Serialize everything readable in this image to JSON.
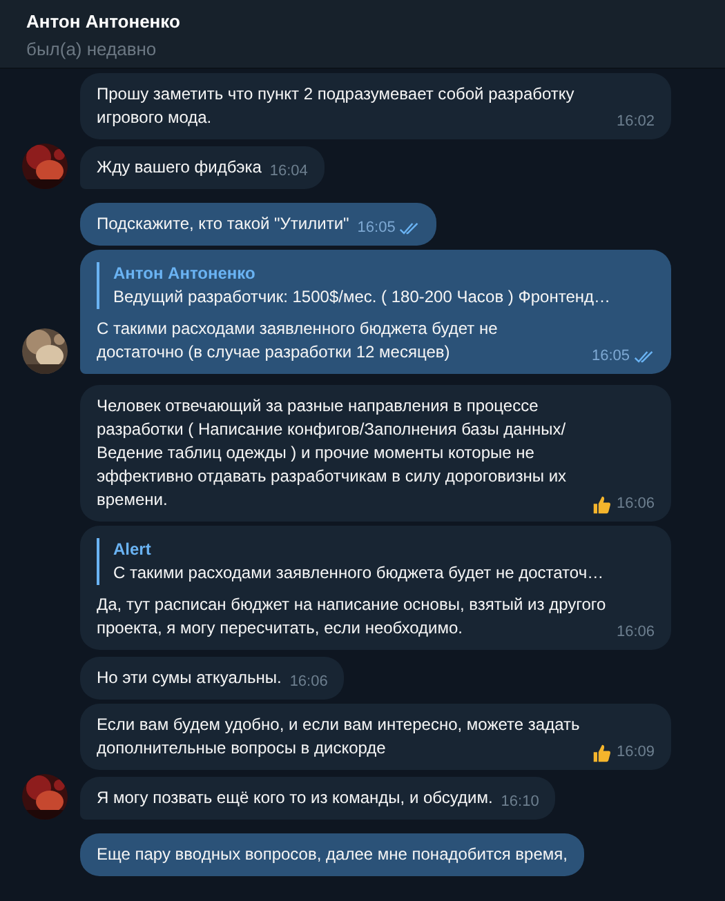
{
  "header": {
    "title": "Антон Антоненко",
    "status": "был(а) недавно"
  },
  "messages": [
    {
      "outgoing": false,
      "text": "Прошу заметить что пункт 2 подразумевает собой разработку игрового мода.",
      "time": "16:02",
      "avatar": false
    },
    {
      "outgoing": false,
      "text": "Жду вашего фидбэка",
      "time": "16:04",
      "avatar": true
    },
    {
      "outgoing": true,
      "text": "Подскажите, кто такой \"Утилити\"",
      "time": "16:05",
      "read": true,
      "avatar": false
    },
    {
      "outgoing": true,
      "reply": {
        "author": "Антон Антоненко",
        "text": "Ведущий разработчик: 1500$/мес. ( 180-200 Часов )  Фронтенд…"
      },
      "text": "С такими расходами заявленного бюджета будет не достаточно (в случае разработки 12 месяцев)",
      "time": "16:05",
      "read": true,
      "avatar": true
    },
    {
      "outgoing": false,
      "text": "Человек отвечающий за разные направления в процессе разработки ( Написание конфигов/Заполнения базы данных/ Ведение таблиц одежды ) и прочие моменты которые не эффективно отдавать разработчикам в силу дороговизны их времени.",
      "time": "16:06",
      "reacted": true,
      "avatar": false
    },
    {
      "outgoing": false,
      "reply": {
        "author": "Alert",
        "text": "С такими расходами заявленного бюджета будет не достаточ…"
      },
      "text": "Да, тут расписан бюджет на написание основы, взятый из другого проекта, я могу пересчитать, если необходимо.",
      "time": "16:06",
      "avatar": false
    },
    {
      "outgoing": false,
      "text": "Но эти сумы аткуальны.",
      "time": "16:06",
      "avatar": false
    },
    {
      "outgoing": false,
      "text": "Если вам будем удобно, и если вам интересно, можете задать дополнительные вопросы в дискорде",
      "time": "16:09",
      "reacted": true,
      "avatar": false
    },
    {
      "outgoing": false,
      "text": "Я могу позвать ещё кого то из команды, и обсудим.",
      "time": "16:10",
      "avatar": true
    },
    {
      "outgoing": true,
      "text": "Еще пару вводных вопросов, далее мне понадобится время,",
      "avatar": false
    }
  ]
}
